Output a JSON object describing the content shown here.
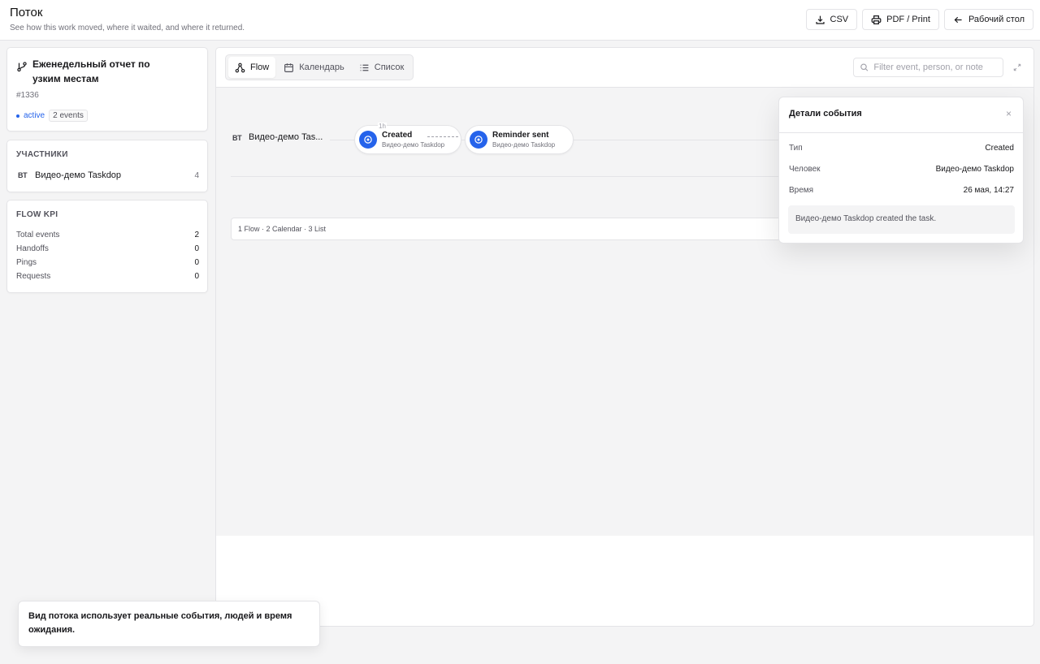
{
  "header": {
    "title": "Поток",
    "subtitle": "See how this work moved, where it waited, and where it returned.",
    "csv_label": "CSV",
    "pdf_label": "PDF / Print",
    "back_label": "Рабочий стол"
  },
  "task": {
    "title": "Еженедельный отчет по узким местам",
    "id": "#1336",
    "status": "active",
    "events_badge": "2 events"
  },
  "participants": {
    "heading": "УЧАСТНИКИ",
    "items": [
      {
        "initials": "ВТ",
        "name": "Видео-демо Taskdop",
        "count": "4"
      }
    ]
  },
  "kpi": {
    "heading": "FLOW KPI",
    "rows": [
      {
        "label": "Total events",
        "value": "2"
      },
      {
        "label": "Handoffs",
        "value": "0"
      },
      {
        "label": "Pings",
        "value": "0"
      },
      {
        "label": "Requests",
        "value": "0"
      }
    ]
  },
  "views": {
    "tabs": [
      {
        "label": "Flow",
        "icon": "flow-icon",
        "active": true
      },
      {
        "label": "Календарь",
        "icon": "calendar-icon",
        "active": false
      },
      {
        "label": "Список",
        "icon": "list-icon",
        "active": false
      }
    ],
    "filter_placeholder": "Filter event, person, or note"
  },
  "flow": {
    "lane": {
      "initials": "ВТ",
      "name": "Видео-демо Tas..."
    },
    "wait_label": "1h",
    "nodes": [
      {
        "title": "Created",
        "person": "Видео-демо Taskdop"
      },
      {
        "title": "Reminder sent",
        "person": "Видео-демо Taskdop"
      }
    ],
    "shortcuts": "1 Flow · 2 Calendar · 3 List"
  },
  "details": {
    "title": "Детали события",
    "close": "×",
    "rows": [
      {
        "label": "Тип",
        "value": "Created"
      },
      {
        "label": "Человек",
        "value": "Видео-демо Taskdop"
      },
      {
        "label": "Время",
        "value": "26 мая, 14:27"
      }
    ],
    "note": "Видео-демо Taskdop created the task."
  },
  "toast": {
    "text": "Вид потока использует реальные события, людей и время ожидания."
  },
  "colors": {
    "accent": "#2563eb",
    "background": "#f4f4f5",
    "border": "#e4e4e7"
  }
}
